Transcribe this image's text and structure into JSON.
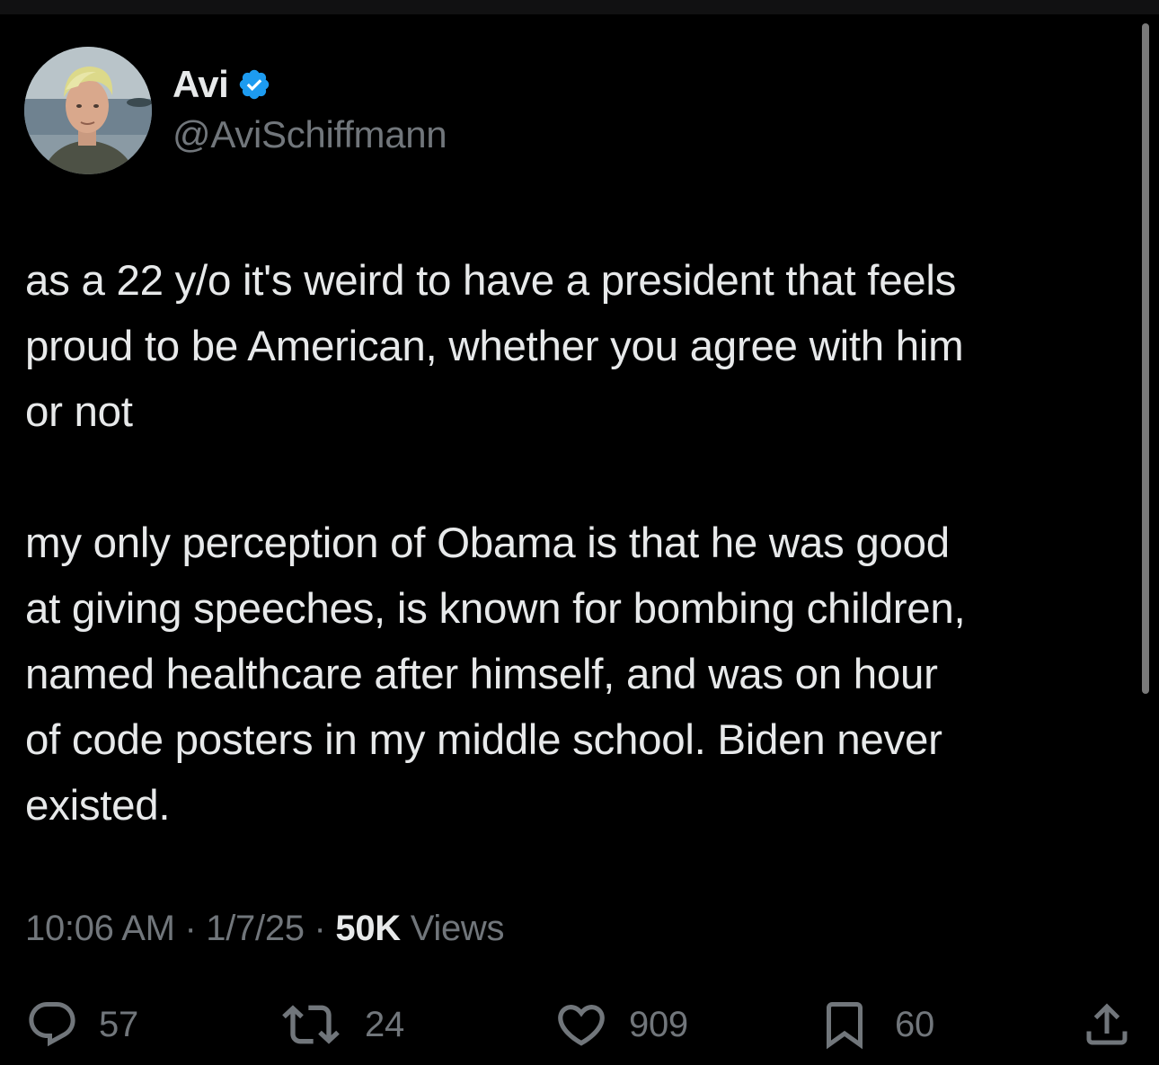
{
  "tweet": {
    "author": {
      "display_name": "Avi",
      "handle": "@AviSchiffmann",
      "verified_icon": "verified-badge-icon",
      "avatar_icon": "user-avatar"
    },
    "text_lines_1": [
      "as a 22 y/o it's weird to have a president that feels",
      "proud to be American, whether you agree with him",
      "or not"
    ],
    "text_lines_2": [
      "my only perception of Obama is that he was good",
      "at giving speeches, is known for bombing children,",
      "named healthcare after himself, and was on hour",
      "of code posters in my middle school. Biden never",
      "existed."
    ],
    "meta": {
      "time": "10:06 AM",
      "separator": "·",
      "date": "1/7/25",
      "views_count": "50K",
      "views_label": "Views"
    },
    "actions": {
      "replies": {
        "icon": "reply-icon",
        "count": "57"
      },
      "reposts": {
        "icon": "repost-icon",
        "count": "24"
      },
      "likes": {
        "icon": "heart-icon",
        "count": "909"
      },
      "bookmarks": {
        "icon": "bookmark-icon",
        "count": "60"
      },
      "share": {
        "icon": "share-icon"
      }
    }
  },
  "colors": {
    "background": "#000000",
    "primary_text": "#e7e9ea",
    "secondary_text": "#71767b",
    "verified_blue": "#1d9bf0"
  }
}
